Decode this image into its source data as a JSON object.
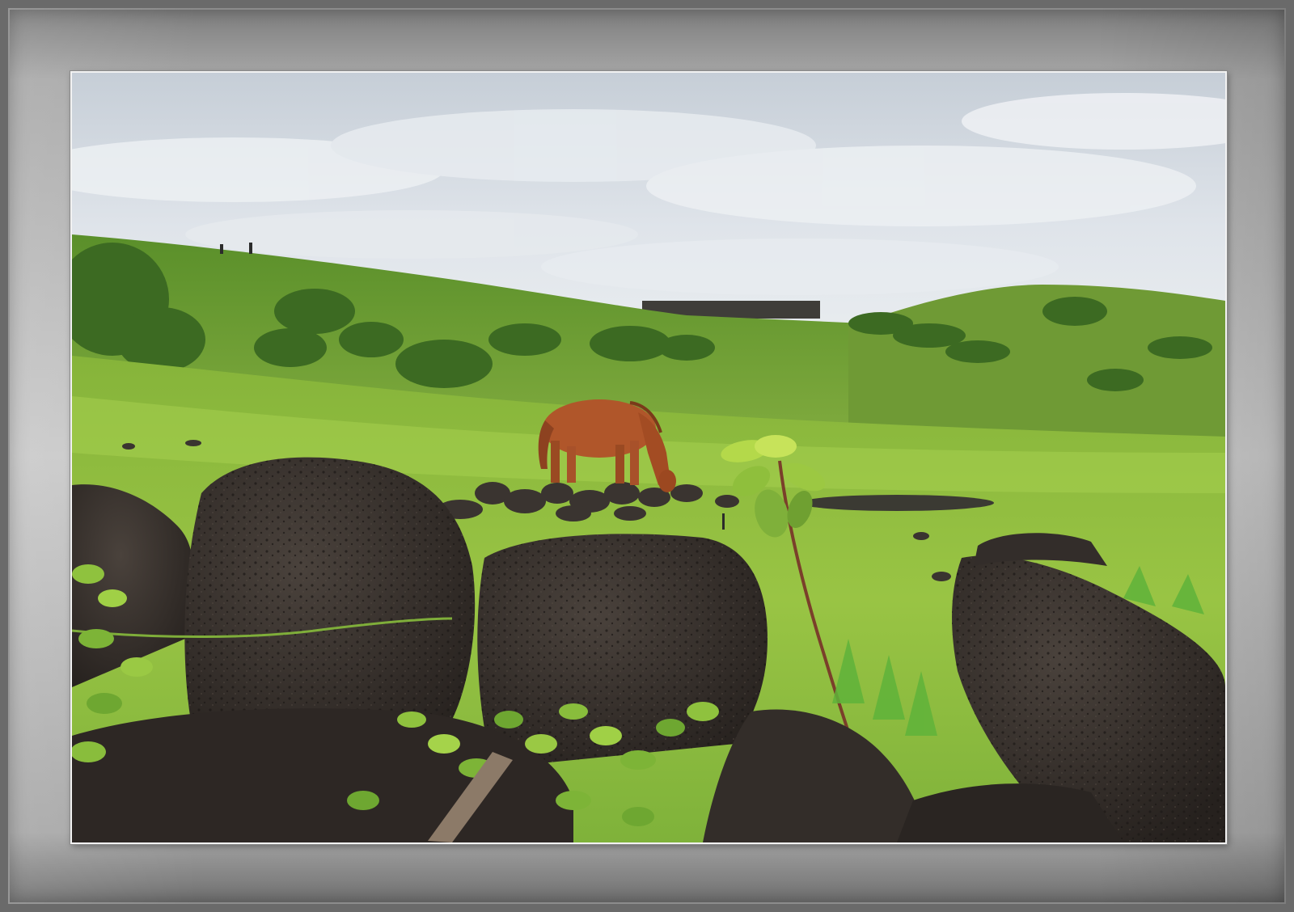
{
  "scene": {
    "subject": "horse-grazing",
    "colors": {
      "sky": "#d7dde3",
      "cloud": "#eef1f4",
      "hill_dark": "#3f6b26",
      "hill_mid": "#6f9a35",
      "meadow": "#8fbf3c",
      "meadow_light": "#a6cf4e",
      "horse": "#b0562a",
      "rock": "#3a3430",
      "rock_dark": "#2a2522",
      "frame_outer": "#6a6a6a",
      "frame_mat": "#c4c4c4",
      "photo_border": "#f2f2f2"
    }
  }
}
